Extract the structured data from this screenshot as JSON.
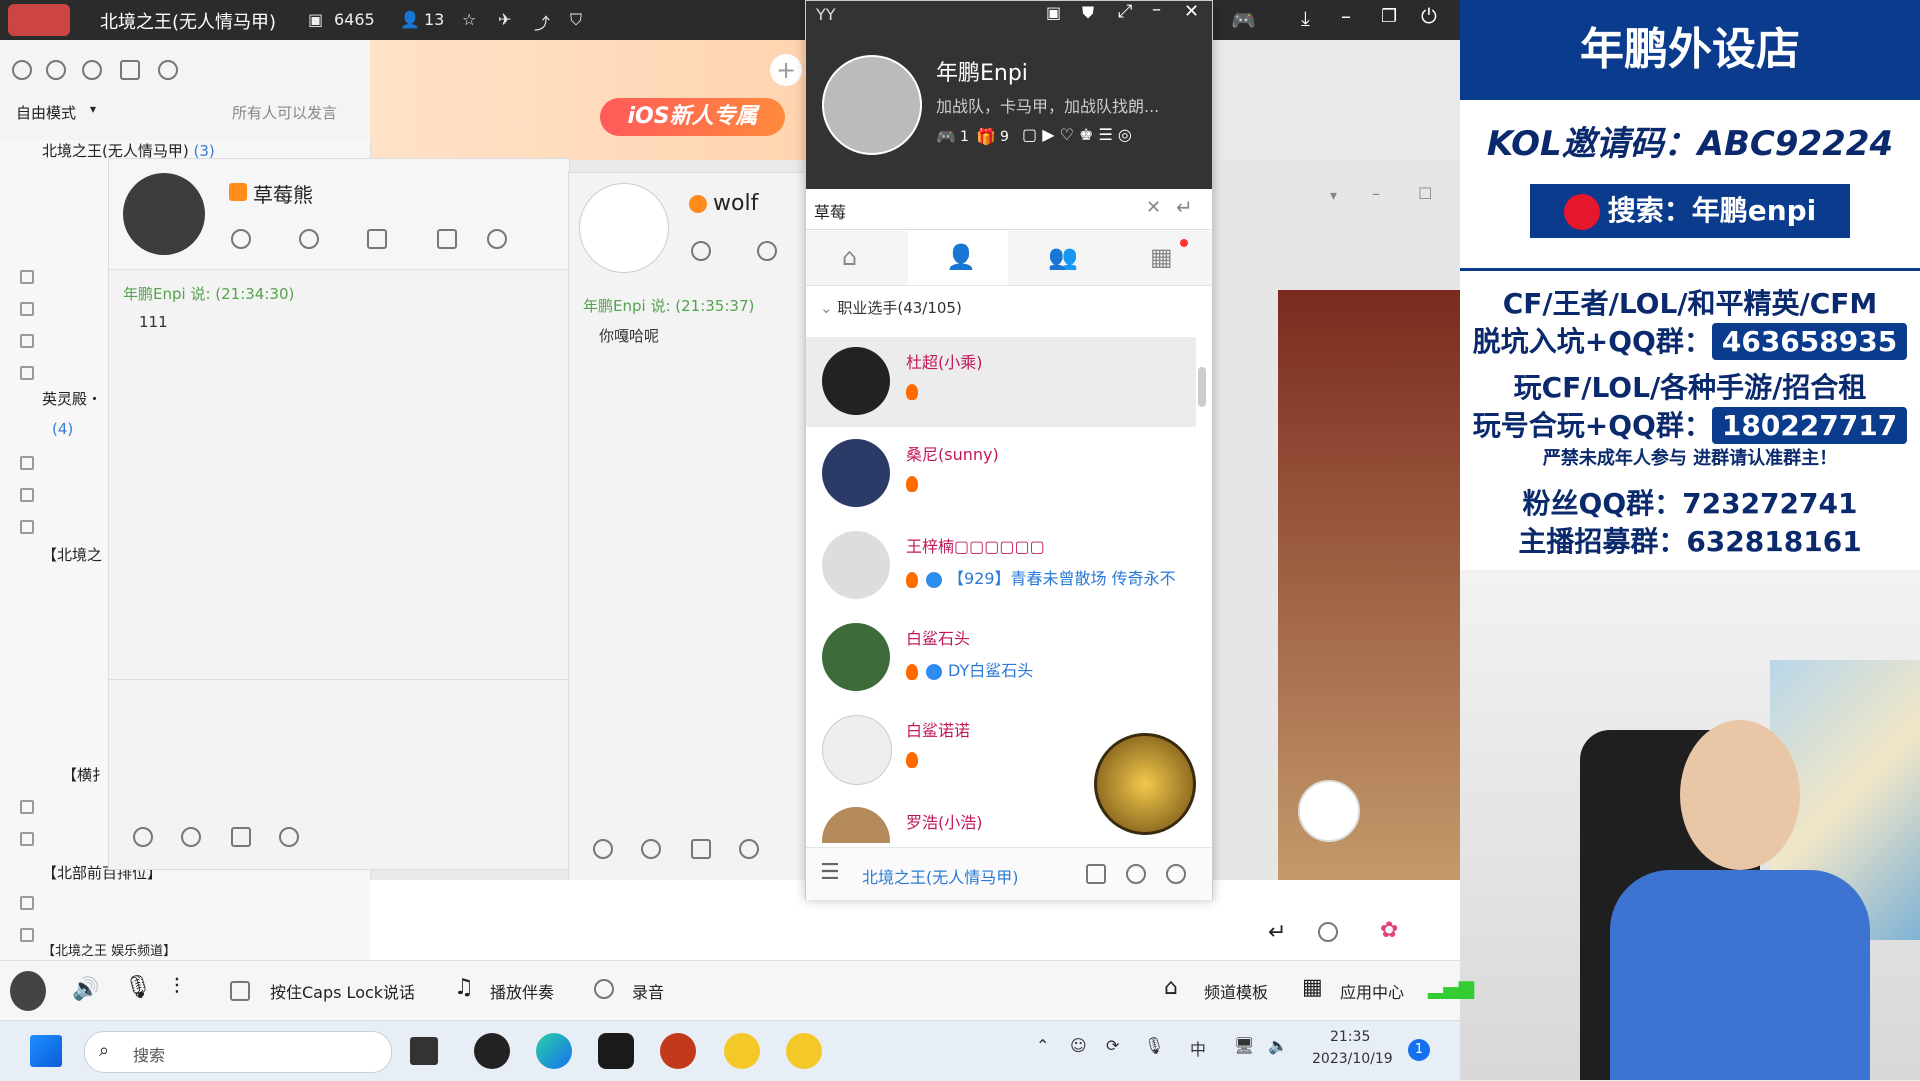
{
  "topbar": {
    "title": "北境之王(无人情马甲)",
    "room_id": "6465",
    "online": "13"
  },
  "left": {
    "mode": "自由模式",
    "permission": "所有人可以发言",
    "channel_root": "北境之王(无人情马甲)",
    "channel_root_count": "(3)",
    "channels": [
      "英灵殿・",
      "(4)",
      "【北境之",
      "【横扌",
      "【北部前百排位】",
      "【北境之王 娱乐频道】"
    ]
  },
  "chat1": {
    "name": "草莓熊",
    "sender": "年鹏Enpi 说: (21:34:30)",
    "message": "111"
  },
  "chat2": {
    "name": "wolf",
    "sender": "年鹏Enpi 说: (21:35:37)",
    "message": "你嘎哈呢"
  },
  "banner": {
    "text": "iOS新人专属"
  },
  "popup": {
    "window_title": "YY",
    "profile_name": "年鹏Enpi",
    "profile_sign": "加战队，卡马甲，加战队找朗...",
    "badge1": "1",
    "badge2": "9",
    "search_value": "草莓",
    "group_header": "职业选手(43/105)",
    "contacts": [
      {
        "name": "杜超(小乘)",
        "line": ""
      },
      {
        "name": "桑尼(sunny)",
        "line": ""
      },
      {
        "name": "王梓楠▢▢▢▢▢▢",
        "line": "【929】青春未曾散场 传奇永不"
      },
      {
        "name": "白鲨石头",
        "line": "DY白鲨石头"
      },
      {
        "name": "白鲨诺诺",
        "line": ""
      },
      {
        "name": "罗浩(小浩)",
        "line": ""
      }
    ],
    "footer_channel": "北境之王(无人情马甲)"
  },
  "stream": {
    "shop": "年鹏外设店",
    "kol": "KOL邀请码：ABC92224",
    "weibo": "搜索：年鹏enpi",
    "games": "CF/王者/LOL/和平精英/CFM",
    "qq1_label": "脱坑入坑+QQ群：",
    "qq1": "463658935",
    "rent": "玩CF/LOL/各种手游/招合租",
    "qq2_label": "玩号合玩+QQ群：",
    "qq2": "180227717",
    "notice": "严禁未成年人参与  进群请认准群主！",
    "fans_label": "粉丝QQ群：",
    "fans": "723272741",
    "host_label": "主播招募群：",
    "host": "632818161"
  },
  "bottom": {
    "caps": "按住Caps Lock说话",
    "music": "播放伴奏",
    "record": "录音",
    "template": "频道模板",
    "appcenter": "应用中心"
  },
  "taskbar": {
    "search": "搜索",
    "ime": "中",
    "time": "21:35",
    "date": "2023/10/19",
    "notify": "1"
  }
}
